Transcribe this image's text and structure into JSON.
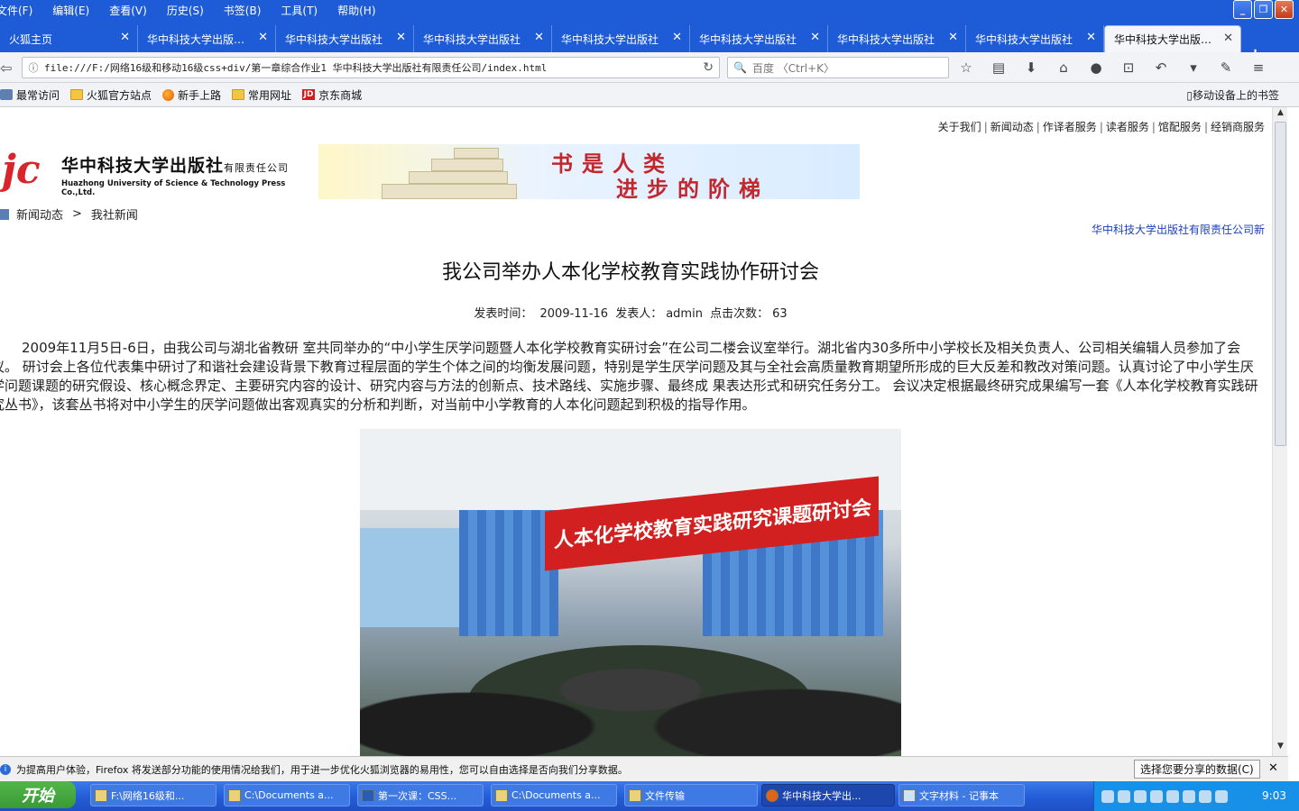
{
  "menubar": {
    "items": [
      "文件(F)",
      "编辑(E)",
      "查看(V)",
      "历史(S)",
      "书签(B)",
      "工具(T)",
      "帮助(H)"
    ]
  },
  "tabs": [
    {
      "label": "火狐主页"
    },
    {
      "label": "华中科技大学出版…"
    },
    {
      "label": "华中科技大学出版社"
    },
    {
      "label": "华中科技大学出版社"
    },
    {
      "label": "华中科技大学出版社"
    },
    {
      "label": "华中科技大学出版社"
    },
    {
      "label": "华中科技大学出版社"
    },
    {
      "label": "华中科技大学出版社"
    },
    {
      "label": "华中科技大学出版…"
    }
  ],
  "navbar": {
    "url": "file:///F:/网络16级和移动16级css+div/第一章综合作业1 华中科技大学出版社有限责任公司/index.html",
    "search_placeholder": "百度 〈Ctrl+K〉"
  },
  "bookmarks": {
    "items": [
      "最常访问",
      "火狐官方站点",
      "新手上路",
      "常用网址",
      "京东商城"
    ],
    "mobile": "移动设备上的书签"
  },
  "site": {
    "toplinks": [
      "关于我们",
      "新闻动态",
      "作译者服务",
      "读者服务",
      "馆配服务",
      "经销商服务"
    ],
    "logo_mark": "jc",
    "logo_cn": "华中科技大学出版社",
    "logo_cn_suffix": "有限责任公司",
    "logo_en": "Huazhong University of Science & Technology Press Co.,Ltd.",
    "banner_line1": "书是人类",
    "banner_line2": "进步的阶梯",
    "breadcrumb": [
      "新闻动态",
      "我社新闻"
    ],
    "breadcrumb_sep": ">",
    "right_link": "华中科技大学出版社有限责任公司新"
  },
  "article": {
    "title": "我公司举办人本化学校教育实践协作研讨会",
    "meta_time_label": "发表时间：",
    "meta_time": "2009-11-16",
    "meta_author_label": "发表人：",
    "meta_author": "admin",
    "meta_clicks_label": "点击次数：",
    "meta_clicks": "63",
    "body": "2009年11月5日-6日，由我公司与湖北省教研 室共同举办的“中小学生厌学问题暨人本化学校教育实研讨会”在公司二楼会议室举行。湖北省内30多所中小学校长及相关负责人、公司相关编辑人员参加了会议。 研讨会上各位代表集中研讨了和谐社会建设背景下教育过程层面的学生个体之间的均衡发展问题，特别是学生厌学问题及其与全社会高质量教育期望所形成的巨大反差和教改对策问题。认真讨论了中小学生厌学问题课题的研究假设、核心概念界定、主要研究内容的设计、研究内容与方法的创新点、技术路线、实施步骤、最终成 果表达形式和研究任务分工。 会议决定根据最终研究成果编写一套《人本化学校教育实践研究丛书》，该套丛书将对中小学生的厌学问题做出客观真实的分析和判断，对当前中小学教育的人本化问题起到积极的指导作用。",
    "photo_banner": "人本化学校教育实践研究课题研讨会"
  },
  "notification": {
    "text": "为提高用户体验，Firefox 将发送部分功能的使用情况给我们，用于进一步优化火狐浏览器的易用性，您可以自由选择是否向我们分享数据。",
    "button": "选择您要分享的数据(C)"
  },
  "taskbar": {
    "start": "开始",
    "items": [
      "F:\\网络16级和...",
      "C:\\Documents a...",
      "第一次课：CSS...",
      "C:\\Documents a...",
      "文件传输",
      "华中科技大学出...",
      "文字材料 - 记事本"
    ],
    "clock": "9:03"
  }
}
